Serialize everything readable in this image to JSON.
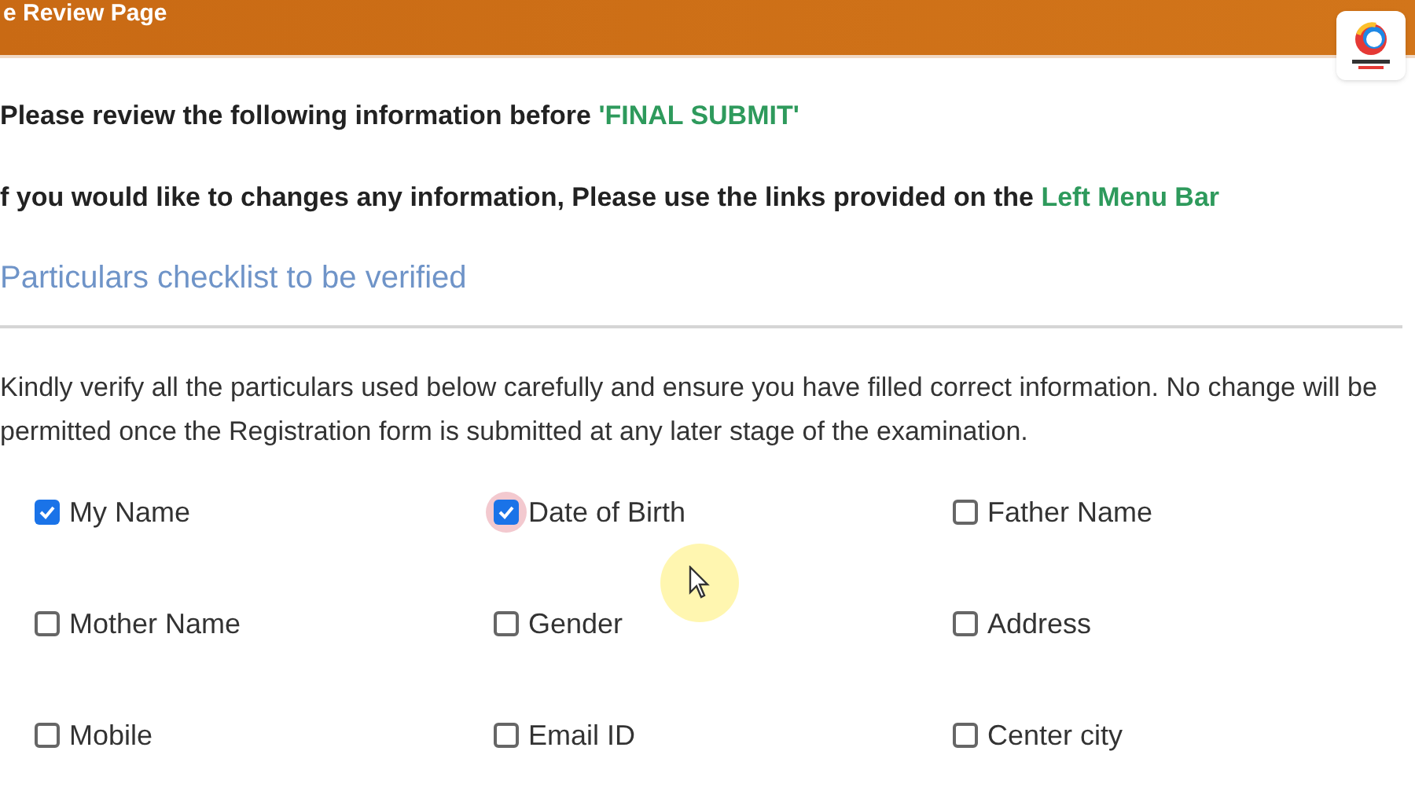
{
  "header": {
    "title": "e Review Page"
  },
  "intro": {
    "text": "Please review the following information before ",
    "highlight": "'FINAL SUBMIT'"
  },
  "instruction": {
    "text": "f you would like to changes any information, Please use the links provided on the ",
    "link": "Left Menu Bar"
  },
  "section_title": "Particulars checklist to be verified",
  "notice": "Kindly verify all the particulars used below carefully and ensure you have filled correct information. No change will be permitted once the Registration form is submitted at any later stage of the examination.",
  "checklist": [
    {
      "label": "My Name",
      "checked": true,
      "focused": false
    },
    {
      "label": "Date of Birth",
      "checked": true,
      "focused": true
    },
    {
      "label": "Father Name",
      "checked": false,
      "focused": false
    },
    {
      "label": "Mother Name",
      "checked": false,
      "focused": false
    },
    {
      "label": "Gender",
      "checked": false,
      "focused": false
    },
    {
      "label": "Address",
      "checked": false,
      "focused": false
    },
    {
      "label": "Mobile",
      "checked": false,
      "focused": false
    },
    {
      "label": "Email ID",
      "checked": false,
      "focused": false
    },
    {
      "label": "Center city",
      "checked": false,
      "focused": false
    }
  ]
}
